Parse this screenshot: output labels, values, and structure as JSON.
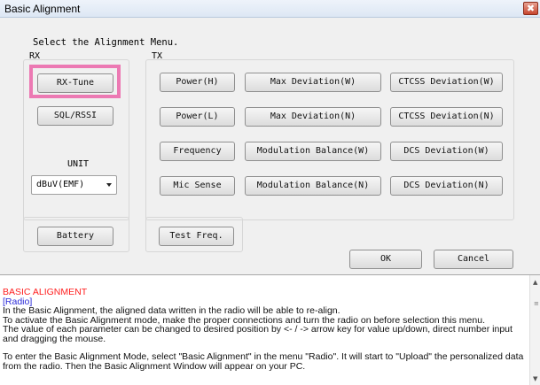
{
  "window": {
    "title": "Basic Alignment",
    "close_label": "✖"
  },
  "prompt": "Select the Alignment Menu.",
  "rx": {
    "label": "RX",
    "buttons": [
      "RX-Tune",
      "SQL/RSSI"
    ],
    "unit_label": "UNIT",
    "unit_select": "dBuV(EMF)",
    "battery": "Battery"
  },
  "tx": {
    "label": "TX",
    "col1": [
      "Power(H)",
      "Power(L)",
      "Frequency",
      "Mic Sense"
    ],
    "col2": [
      "Max Deviation(W)",
      "Max Deviation(N)",
      "Modulation Balance(W)",
      "Modulation Balance(N)"
    ],
    "col3": [
      "CTCSS Deviation(W)",
      "CTCSS Deviation(N)",
      "DCS Deviation(W)",
      "DCS Deviation(N)"
    ],
    "test_freq": "Test Freq."
  },
  "actions": {
    "ok": "OK",
    "cancel": "Cancel"
  },
  "help": {
    "heading": "BASIC ALIGNMENT",
    "subheading": "[Radio]",
    "lines": [
      "In the Basic Alignment, the aligned data written in the radio will be able to re-align.",
      "To activate the Basic Alignment mode, make the proper connections and turn the radio on before selection this menu.",
      "The value of each parameter can be changed to desired position by <- / -> arrow key for value up/down, direct number input and dragging the mouse."
    ],
    "line2": "To enter the Basic Alignment Mode, select \"Basic Alignment\" in the menu \"Radio\". It will start to \"Upload\" the personalized data from the radio. Then the Basic Alignment Window will appear on your PC."
  }
}
